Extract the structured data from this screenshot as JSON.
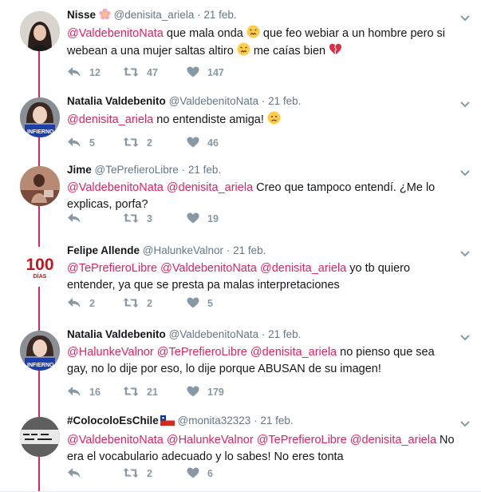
{
  "tweets": [
    {
      "name": "Nisse",
      "handle": "@denisita_ariela",
      "date": "21 feb.",
      "parts": [
        {
          "t": "m",
          "v": "@ValdebenitoNata"
        },
        {
          "t": "s",
          "v": " que mala onda "
        },
        {
          "t": "e",
          "v": "confounded"
        },
        {
          "t": "s",
          "v": " que feo webiar a un hombre pero si webean a una mujer saltas altiro "
        },
        {
          "t": "e",
          "v": "confounded"
        },
        {
          "t": "s",
          "v": " me caías bien "
        },
        {
          "t": "e",
          "v": "broken-heart"
        }
      ],
      "replies": "12",
      "retweets": "47",
      "likes": "147"
    },
    {
      "name": "Natalia Valdebenito",
      "handle": "@ValdebenitoNata",
      "date": "21 feb.",
      "parts": [
        {
          "t": "m",
          "v": "@denisita_ariela"
        },
        {
          "t": "s",
          "v": " no entendiste amiga! "
        },
        {
          "t": "e",
          "v": "crying"
        }
      ],
      "replies": "5",
      "retweets": "2",
      "likes": "46"
    },
    {
      "name": "Jime",
      "handle": "@TePrefieroLibre",
      "date": "21 feb.",
      "parts": [
        {
          "t": "m",
          "v": "@ValdebenitoNata"
        },
        {
          "t": "s",
          "v": " "
        },
        {
          "t": "m",
          "v": "@denisita_ariela"
        },
        {
          "t": "s",
          "v": " Creo que tampoco entendí. ¿Me lo explicas, porfa?"
        }
      ],
      "replies": "",
      "retweets": "3",
      "likes": "19"
    },
    {
      "name": "Felipe Allende",
      "handle": "@HalunkeValnor",
      "date": "21 feb.",
      "parts": [
        {
          "t": "m",
          "v": "@TePrefieroLibre"
        },
        {
          "t": "s",
          "v": " "
        },
        {
          "t": "m",
          "v": "@ValdebenitoNata"
        },
        {
          "t": "s",
          "v": " "
        },
        {
          "t": "m",
          "v": "@denisita_ariela"
        },
        {
          "t": "s",
          "v": " yo tb quiero entender, ya que se presta pa malas interpretaciones"
        }
      ],
      "avatar_text_big": "100",
      "avatar_text_small": "DÍAS",
      "replies": "2",
      "retweets": "2",
      "likes": "5"
    },
    {
      "name": "Natalia Valdebenito",
      "handle": "@ValdebenitoNata",
      "date": "21 feb.",
      "parts": [
        {
          "t": "m",
          "v": "@HalunkeValnor"
        },
        {
          "t": "s",
          "v": " "
        },
        {
          "t": "m",
          "v": "@TePrefieroLibre"
        },
        {
          "t": "s",
          "v": " "
        },
        {
          "t": "m",
          "v": "@denisita_ariela"
        },
        {
          "t": "s",
          "v": " no pienso que sea gay, no lo dije por eso, lo dije porque ABUSAN de su imagen!"
        }
      ],
      "replies": "16",
      "retweets": "21",
      "likes": "179"
    },
    {
      "name": "#ColocoloEsChile",
      "handle": "@monita32323",
      "date": "21 feb.",
      "parts": [
        {
          "t": "m",
          "v": "@ValdebenitoNata"
        },
        {
          "t": "s",
          "v": " "
        },
        {
          "t": "m",
          "v": "@HalunkeValnor"
        },
        {
          "t": "s",
          "v": " "
        },
        {
          "t": "m",
          "v": "@TePrefieroLibre"
        },
        {
          "t": "s",
          "v": " "
        },
        {
          "t": "m",
          "v": "@denisita_ariela"
        },
        {
          "t": "s",
          "v": " No era el vocabulario adecuado y lo sabes! No eres tonta"
        }
      ],
      "replies": "",
      "retweets": "2",
      "likes": "6"
    }
  ],
  "colors": {
    "mention": "#e0245e",
    "thread": "#e0245e",
    "muted": "#657786",
    "icon": "#8899a6"
  },
  "icons": [
    "reply-icon",
    "retweet-icon",
    "like-icon",
    "caret-down-icon",
    "flower-icon",
    "chile-flag-icon"
  ]
}
